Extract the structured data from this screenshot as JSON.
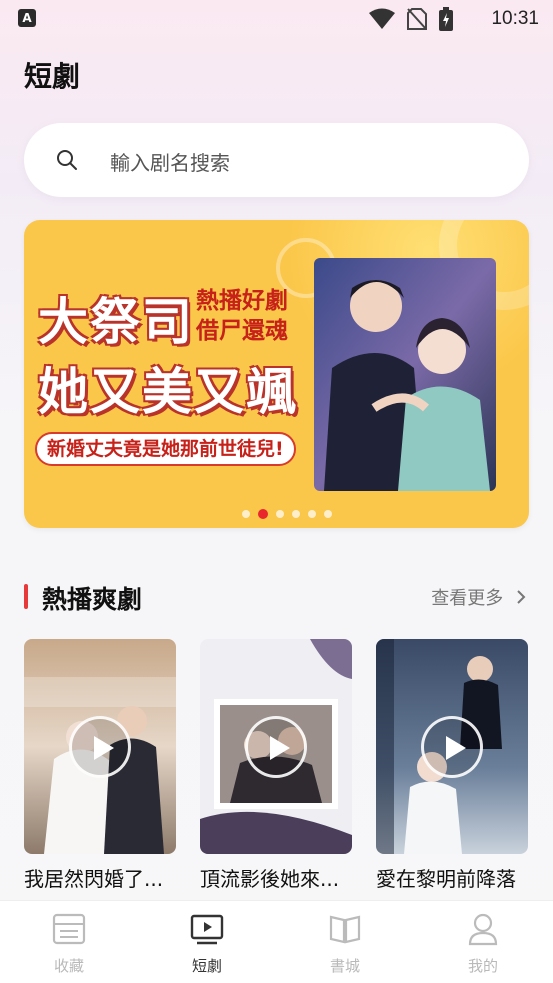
{
  "status_bar": {
    "time": "10:31"
  },
  "header": {
    "title": "短劇"
  },
  "search": {
    "placeholder": "輸入剧名搜索"
  },
  "banner": {
    "title_line1": "大祭司",
    "title_line2": "她又美又颯",
    "subtitle_line1": "熱播好劇",
    "subtitle_line2": "借尸還魂",
    "tagline": "新婚丈夫竟是她那前世徒兒!",
    "dot_count": 6,
    "active_dot": 2
  },
  "hot_section": {
    "title": "熱播爽劇",
    "see_more": "查看更多"
  },
  "dramas": [
    {
      "title": "我居然閃婚了..."
    },
    {
      "title": "頂流影後她來..."
    },
    {
      "title": "愛在黎明前降落"
    }
  ],
  "tab_bar": {
    "tabs": [
      {
        "label": "收藏",
        "icon": "bookmark-list-icon",
        "active": false
      },
      {
        "label": "短劇",
        "icon": "tv-play-icon",
        "active": true
      },
      {
        "label": "書城",
        "icon": "open-book-icon",
        "active": false
      },
      {
        "label": "我的",
        "icon": "person-icon",
        "active": false
      }
    ]
  },
  "colors": {
    "accent": "#e8393a",
    "banner_bg": "#f9c146",
    "active_dot": "#e8262c"
  }
}
